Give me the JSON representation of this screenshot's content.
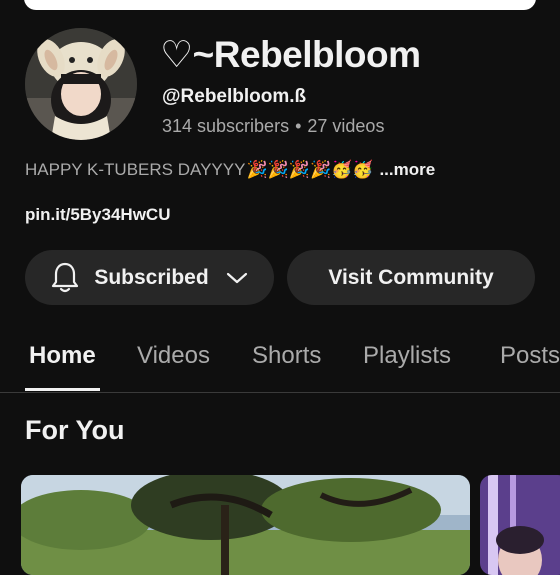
{
  "channel": {
    "name": "♡~Rebelbloom",
    "handle": "@Rebelbloom.ß",
    "subscribers": "314 subscribers",
    "separator": "•",
    "videos": "27 videos",
    "description": "HAPPY K-TUBERS DAYYYY",
    "description_emojis": "🎉🎉🎉🎉🥳🥳",
    "more_label": "...more",
    "link": "pin.it/5By34HwCU"
  },
  "actions": {
    "subscribed_label": "Subscribed",
    "community_label": "Visit Community"
  },
  "tabs": [
    {
      "label": "Home",
      "active": true
    },
    {
      "label": "Videos",
      "active": false
    },
    {
      "label": "Shorts",
      "active": false
    },
    {
      "label": "Playlists",
      "active": false
    },
    {
      "label": "Posts",
      "active": false
    }
  ],
  "section": {
    "title": "For You"
  },
  "icons": {
    "bell": "bell-icon",
    "chevron": "chevron-down-icon"
  },
  "colors": {
    "background": "#0f0f0f",
    "button_bg": "#272727",
    "secondary_text": "#aaaaaa",
    "primary_text": "#f1f1f1"
  }
}
